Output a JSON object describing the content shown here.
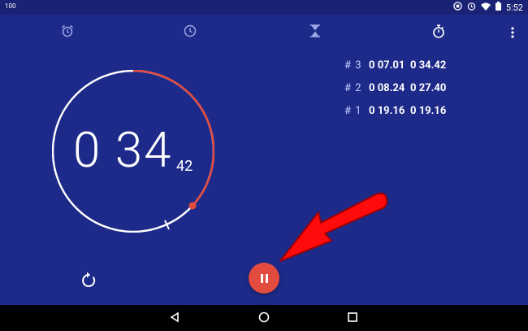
{
  "status": {
    "left_text": "100",
    "time": "5:52"
  },
  "tabs": [
    {
      "name": "alarm",
      "icon": "alarm-icon"
    },
    {
      "name": "clock",
      "icon": "clock-icon"
    },
    {
      "name": "timer",
      "icon": "hourglass-icon"
    },
    {
      "name": "stopwatch",
      "icon": "stopwatch-icon"
    }
  ],
  "stopwatch": {
    "main_time": "0 34",
    "hundredths": "42"
  },
  "laps": [
    {
      "label": "# 3",
      "lap_time": "0 07.01",
      "total_time": "0 34.42"
    },
    {
      "label": "# 2",
      "lap_time": "0 08.24",
      "total_time": "0 27.40"
    },
    {
      "label": "# 1",
      "lap_time": "0 19.16",
      "total_time": "0 19.16"
    }
  ],
  "colors": {
    "background": "#1d2a8a",
    "accent": "#e34b3e",
    "arrow": "#ff0000"
  }
}
